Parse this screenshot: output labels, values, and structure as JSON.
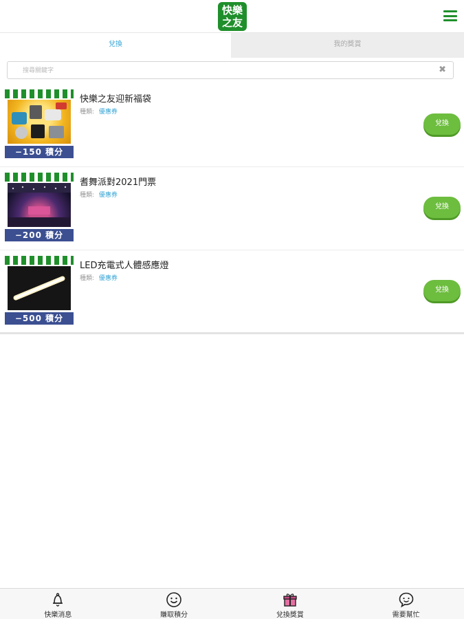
{
  "header": {
    "logo_line1": "快樂",
    "logo_line2": "之友",
    "logo_icon": "logo",
    "menu_icon": "hamburger-menu-icon"
  },
  "tabs": [
    {
      "label": "兌換",
      "active": true
    },
    {
      "label": "我的獎賞",
      "active": false
    }
  ],
  "search": {
    "placeholder": "搜尋關鍵字",
    "value": "",
    "clear_icon": "close-icon"
  },
  "items": [
    {
      "title": "快樂之友迎新福袋",
      "category_label": "種類:",
      "category_value": "優惠券",
      "points": "−150 積分",
      "button": "兌換"
    },
    {
      "title": "耆舞派對2021門票",
      "category_label": "種類:",
      "category_value": "優惠券",
      "points": "−200 積分",
      "button": "兌換"
    },
    {
      "title": "LED充電式人體感應燈",
      "category_label": "種類:",
      "category_value": "優惠券",
      "points": "−500 積分",
      "button": "兌換"
    }
  ],
  "bottom_nav": [
    {
      "label": "快樂消息",
      "icon": "bell-icon"
    },
    {
      "label": "賺取積分",
      "icon": "smiley-icon"
    },
    {
      "label": "兌換獎賞",
      "icon": "gift-icon"
    },
    {
      "label": "需要幫忙",
      "icon": "help-chat-icon"
    }
  ],
  "colors": {
    "brand_green": "#1f8f2b",
    "button_green": "#6dbd3f",
    "accent_blue": "#39a6d6",
    "points_bar": "#3b4f91"
  }
}
